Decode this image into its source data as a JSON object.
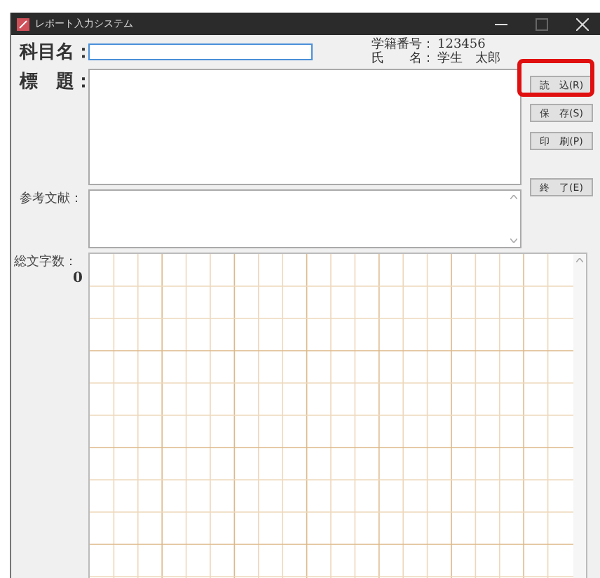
{
  "window": {
    "title": "レポート入力システム"
  },
  "subject": {
    "label": "科目名："
  },
  "student": [
    {
      "label": "学籍番号：",
      "value": "123456"
    },
    {
      "label": "氏　　名：",
      "value": "学生　太郎"
    }
  ],
  "title_field": {
    "label": "標　題："
  },
  "references_field": {
    "label": "参考文献："
  },
  "char_count": {
    "label": "総文字数：",
    "value": "0"
  },
  "buttons": [
    {
      "label": "読　込(R)",
      "highlighted": true
    },
    {
      "label": "保　存(S)",
      "highlighted": false
    },
    {
      "label": "印　刷(P)",
      "highlighted": false
    },
    {
      "label": "終　了(E)",
      "highlighted": false
    }
  ]
}
